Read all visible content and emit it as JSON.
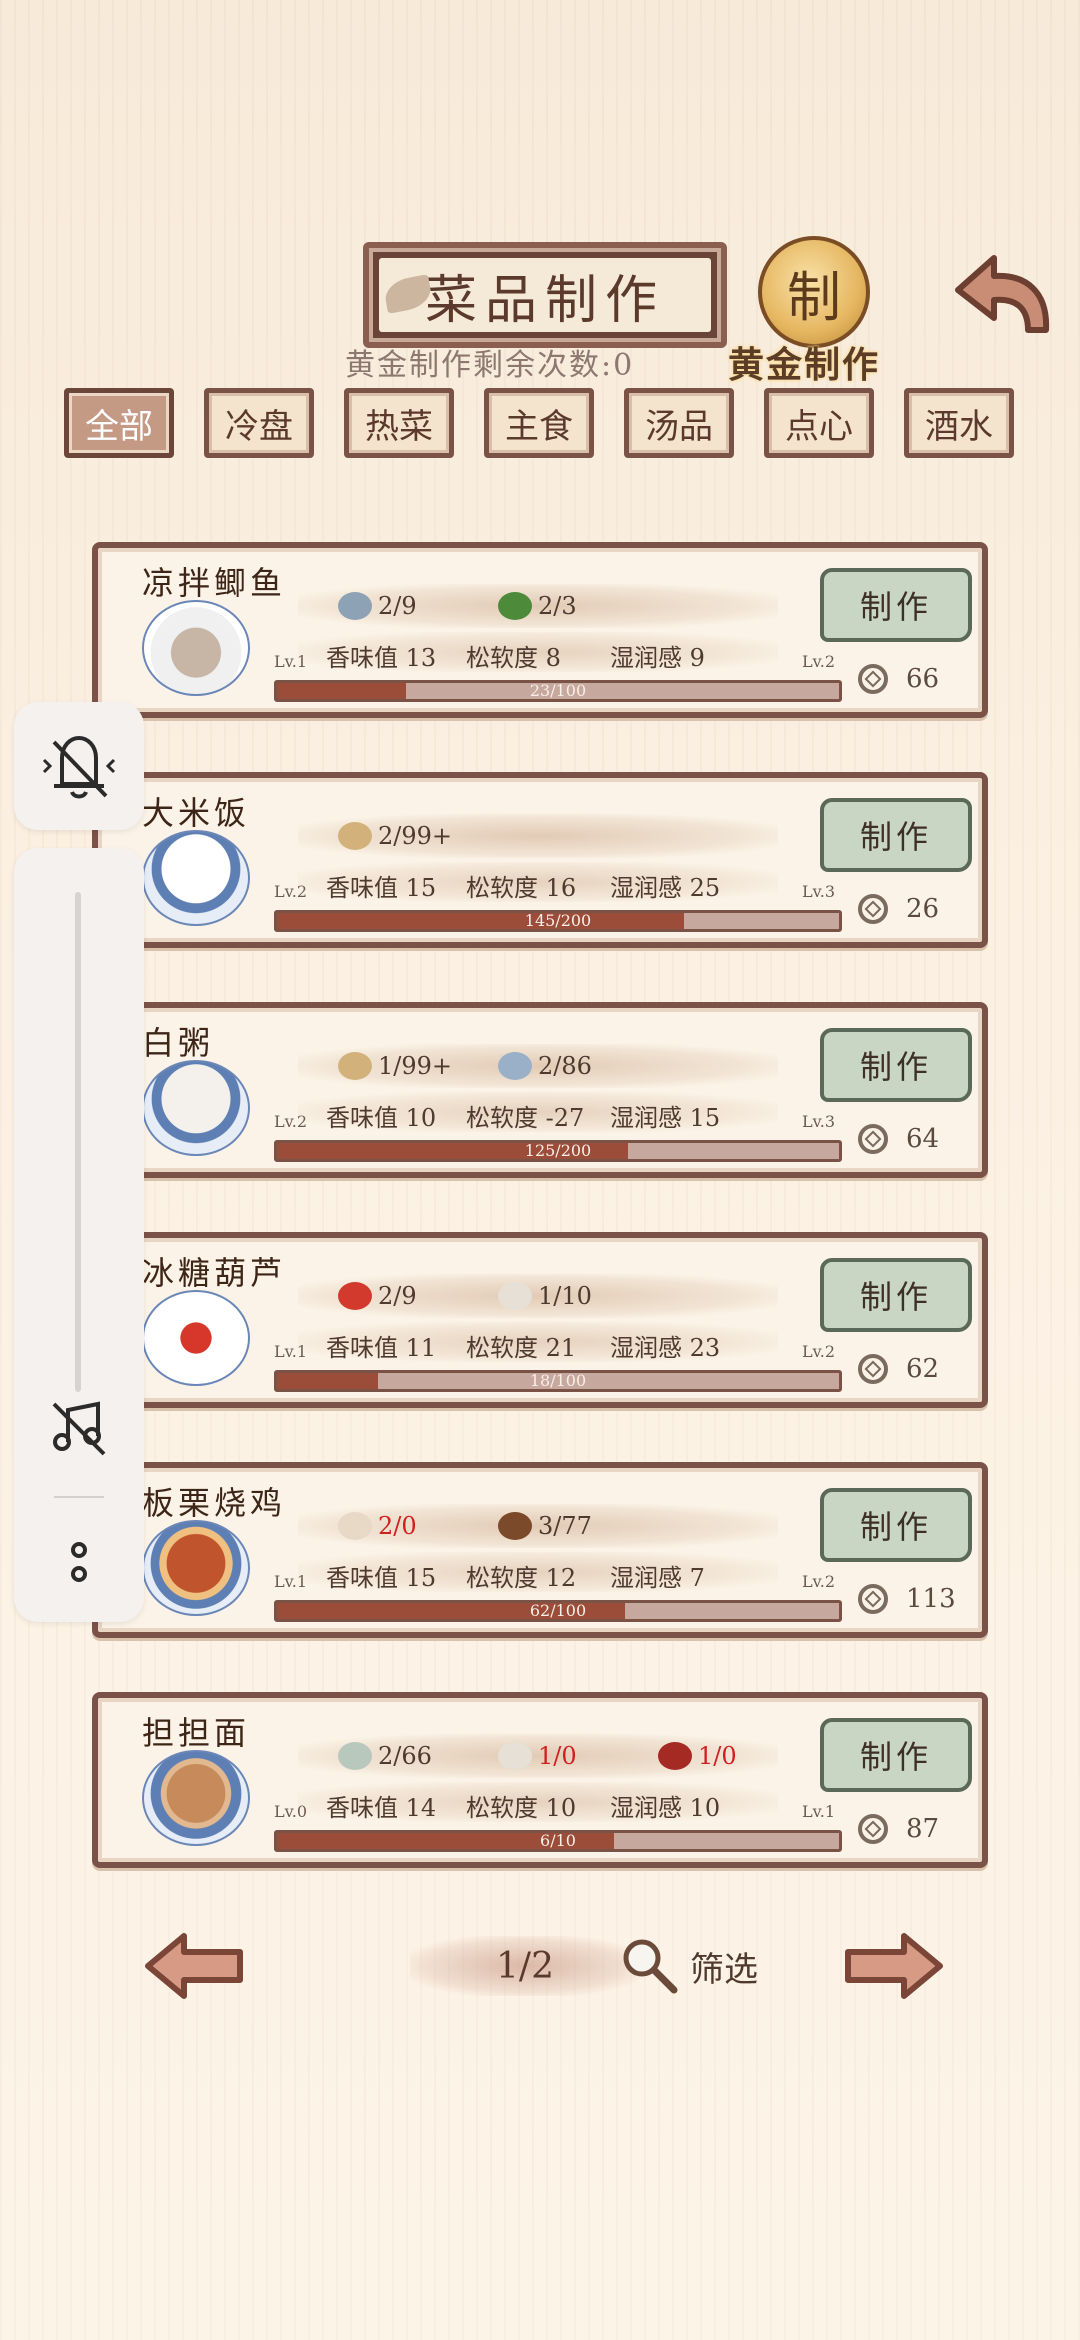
{
  "header": {
    "title": "菜品制作",
    "gold_remaining": "黄金制作剩余次数:0",
    "gold_badge_char": "制",
    "gold_label": "黄金制作"
  },
  "tabs": [
    "全部",
    "冷盘",
    "热菜",
    "主食",
    "汤品",
    "点心",
    "酒水"
  ],
  "recipes": [
    {
      "name": "凉拌鲫鱼",
      "ingredients": [
        {
          "count": "2/9",
          "icon": "fish-icon",
          "short": false
        },
        {
          "count": "2/3",
          "icon": "chili-pepper-icon",
          "short": false
        }
      ],
      "stats": {
        "aroma": "香味值 13",
        "softness": "松软度 8",
        "moisture": "湿润感 9"
      },
      "lv_current": "Lv.1",
      "lv_next": "Lv.2",
      "progress_text": "23/100",
      "progress": 0.23,
      "action": "制作",
      "price": "66"
    },
    {
      "name": "大米饭",
      "ingredients": [
        {
          "count": "2/99+",
          "icon": "rice-stalk-icon",
          "short": false
        }
      ],
      "stats": {
        "aroma": "香味值 15",
        "softness": "松软度 16",
        "moisture": "湿润感 25"
      },
      "lv_current": "Lv.2",
      "lv_next": "Lv.3",
      "progress_text": "145/200",
      "progress": 0.725,
      "action": "制作",
      "price": "26"
    },
    {
      "name": "白粥",
      "ingredients": [
        {
          "count": "1/99+",
          "icon": "rice-stalk-icon",
          "short": false
        },
        {
          "count": "2/86",
          "icon": "bowl-icon",
          "short": false
        }
      ],
      "stats": {
        "aroma": "香味值 10",
        "softness": "松软度 -27",
        "moisture": "湿润感 15"
      },
      "lv_current": "Lv.2",
      "lv_next": "Lv.3",
      "progress_text": "125/200",
      "progress": 0.625,
      "action": "制作",
      "price": "64"
    },
    {
      "name": "冰糖葫芦",
      "ingredients": [
        {
          "count": "2/9",
          "icon": "hawthorn-icon",
          "short": false
        },
        {
          "count": "1/10",
          "icon": "sugar-icon",
          "short": false
        }
      ],
      "stats": {
        "aroma": "香味值 11",
        "softness": "松软度 21",
        "moisture": "湿润感 23"
      },
      "lv_current": "Lv.1",
      "lv_next": "Lv.2",
      "progress_text": "18/100",
      "progress": 0.18,
      "action": "制作",
      "price": "62"
    },
    {
      "name": "板栗烧鸡",
      "ingredients": [
        {
          "count": "2/0",
          "icon": "chicken-icon",
          "short": true
        },
        {
          "count": "3/77",
          "icon": "chestnut-icon",
          "short": false
        }
      ],
      "stats": {
        "aroma": "香味值 15",
        "softness": "松软度 12",
        "moisture": "湿润感 7"
      },
      "lv_current": "Lv.1",
      "lv_next": "Lv.2",
      "progress_text": "62/100",
      "progress": 0.62,
      "action": "制作",
      "price": "113"
    },
    {
      "name": "担担面",
      "ingredients": [
        {
          "count": "2/66",
          "icon": "noodle-icon",
          "short": false
        },
        {
          "count": "1/0",
          "icon": "sugar-icon",
          "short": true
        },
        {
          "count": "1/0",
          "icon": "chili-sauce-icon",
          "short": true
        }
      ],
      "stats": {
        "aroma": "香味值 14",
        "softness": "松软度 10",
        "moisture": "湿润感 10"
      },
      "lv_current": "Lv.0",
      "lv_next": "Lv.1",
      "progress_text": "6/10",
      "progress": 0.6,
      "action": "制作",
      "price": "87"
    }
  ],
  "pagination": {
    "page": "1/2",
    "filter_label": "筛选"
  },
  "overlay": {
    "icons": [
      "vibrate-mute-icon",
      "music-off-icon",
      "more-icon"
    ]
  },
  "colors": {
    "short_red": "#d02020",
    "progress_fill": "#9b4d3a",
    "accent_brown": "#7b5248"
  }
}
